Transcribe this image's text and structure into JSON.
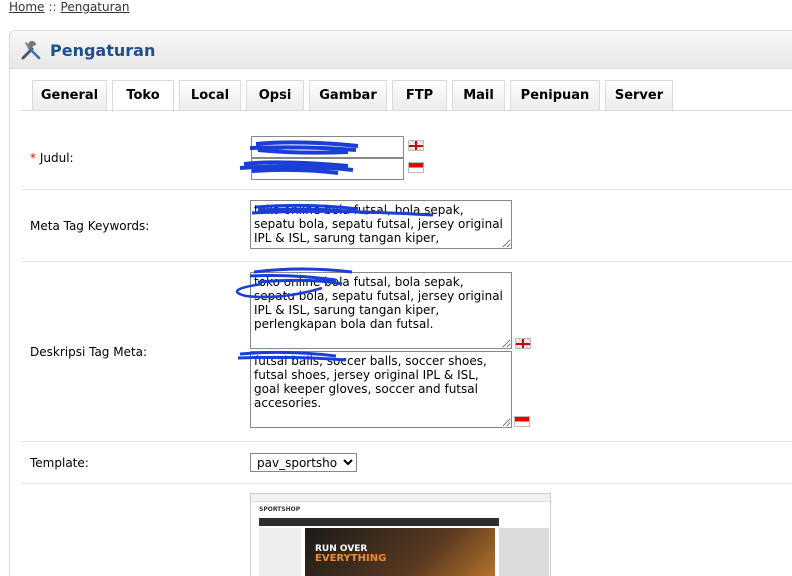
{
  "breadcrumb": {
    "home": "Home",
    "separator": "::",
    "current": "Pengaturan"
  },
  "heading": {
    "title": "Pengaturan",
    "icon": "wrench-screwdriver-icon"
  },
  "tabs": [
    "General",
    "Toko",
    "Local",
    "Opsi",
    "Gambar",
    "FTP",
    "Mail",
    "Penipuan",
    "Server"
  ],
  "active_tab": "Toko",
  "form": {
    "judul": {
      "label": "Judul:",
      "required_mark": "*",
      "value_en": "",
      "value_id": ""
    },
    "meta_keywords": {
      "label": "Meta Tag Keywords:",
      "value": "toko online bola futsal, bola sepak, sepatu bola, sepatu futsal, jersey original IPL & ISL, sarung tangan kiper,"
    },
    "meta_description": {
      "label": "Deskripsi Tag Meta:",
      "value_id": "toko online bola futsal, bola sepak, sepatu bola, sepatu futsal, jersey original IPL & ISL, sarung tangan kiper, perlengkapan bola dan futsal.",
      "value_en": "futsal balls, soccer balls, soccer shoes, futsal shoes, jersey original IPL & ISL, goal keeper gloves, soccer and futsal accesories."
    },
    "template": {
      "label": "Template:",
      "selected": "pav_sportshop"
    }
  },
  "preview": {
    "logo": "SPORTSHOP",
    "hero_line1": "RUN OVER",
    "hero_line2": "EVERYTHING"
  },
  "colors": {
    "heading_title": "#1f4e8c",
    "required": "#ff0000",
    "scribble": "#1b3fd6"
  }
}
